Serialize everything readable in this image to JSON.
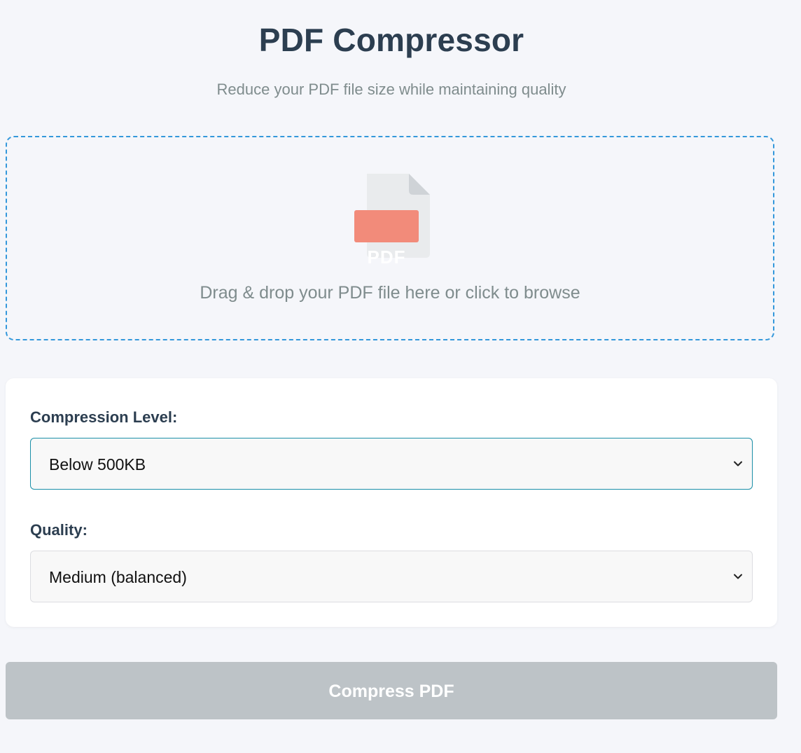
{
  "header": {
    "title": "PDF Compressor",
    "subtitle": "Reduce your PDF file size while maintaining quality"
  },
  "upload": {
    "icon": "pdf-file-icon",
    "icon_badge": "PDF",
    "prompt": "Drag & drop your PDF file here or click to browse",
    "border_color": "#3498db"
  },
  "settings": {
    "compression": {
      "label": "Compression Level:",
      "selected": "Below 500KB"
    },
    "quality": {
      "label": "Quality:",
      "selected": "Medium (balanced)"
    }
  },
  "actions": {
    "compress_label": "Compress PDF",
    "compress_state": "disabled",
    "button_color": "#bdc3c7"
  },
  "colors": {
    "heading": "#2c3e50",
    "muted_text": "#7f8c8d",
    "pdf_badge": "#f28b7a",
    "focus_border": "#1b8fa8"
  }
}
